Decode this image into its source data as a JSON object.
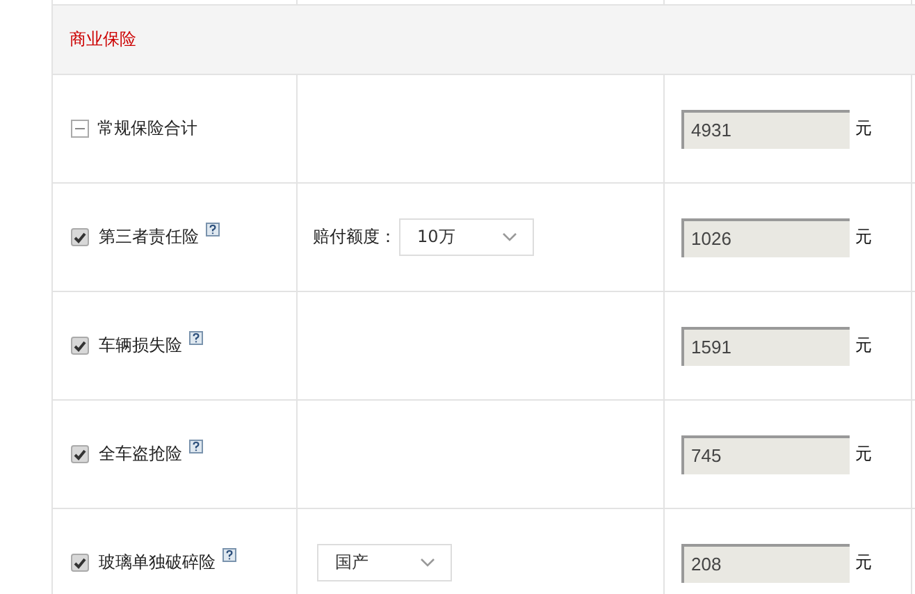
{
  "section": {
    "title": "商业保险"
  },
  "rows": [
    {
      "kind": "total",
      "label": "常规保险合计",
      "expanded": true,
      "value": "4931",
      "unit": "元"
    },
    {
      "kind": "item",
      "label": "第三者责任险",
      "checked": true,
      "help": true,
      "option_label": "赔付额度：",
      "option": "10万",
      "value": "1026",
      "unit": "元"
    },
    {
      "kind": "item",
      "label": "车辆损失险",
      "checked": true,
      "help": true,
      "value": "1591",
      "unit": "元"
    },
    {
      "kind": "item",
      "label": "全车盗抢险",
      "checked": true,
      "help": true,
      "value": "745",
      "unit": "元"
    },
    {
      "kind": "item",
      "label": "玻璃单独破碎险",
      "checked": true,
      "help": true,
      "option": "国产",
      "value": "208",
      "unit": "元"
    }
  ]
}
